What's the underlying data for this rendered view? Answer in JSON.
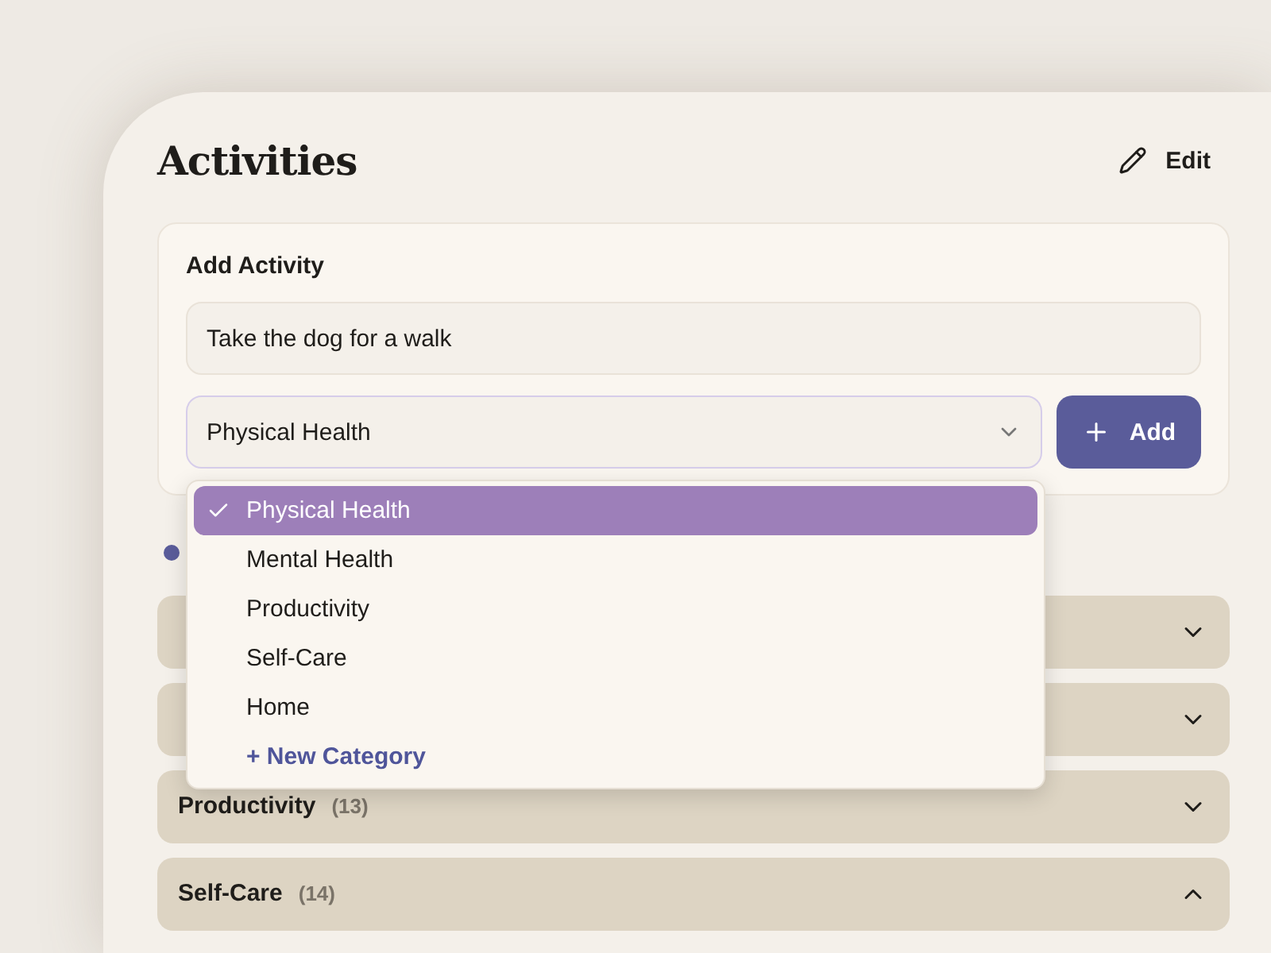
{
  "header": {
    "title": "Activities",
    "edit_label": "Edit"
  },
  "add_form": {
    "heading": "Add Activity",
    "activity_input": {
      "value": "Take the dog for a walk"
    },
    "category_select": {
      "value": "Physical Health",
      "open": true
    },
    "add_button": "Add"
  },
  "category_menu": {
    "options": [
      {
        "label": "Physical Health",
        "selected": true
      },
      {
        "label": "Mental Health",
        "selected": false
      },
      {
        "label": "Productivity",
        "selected": false
      },
      {
        "label": "Self-Care",
        "selected": false
      },
      {
        "label": "Home",
        "selected": false
      }
    ],
    "new_category": "+ New Category"
  },
  "categories": [
    {
      "expanded": false
    },
    {
      "expanded": false
    },
    {
      "name": "Productivity",
      "count": "(13)",
      "expanded": false
    },
    {
      "name": "Self-Care",
      "count": "(14)",
      "expanded": true
    }
  ]
}
